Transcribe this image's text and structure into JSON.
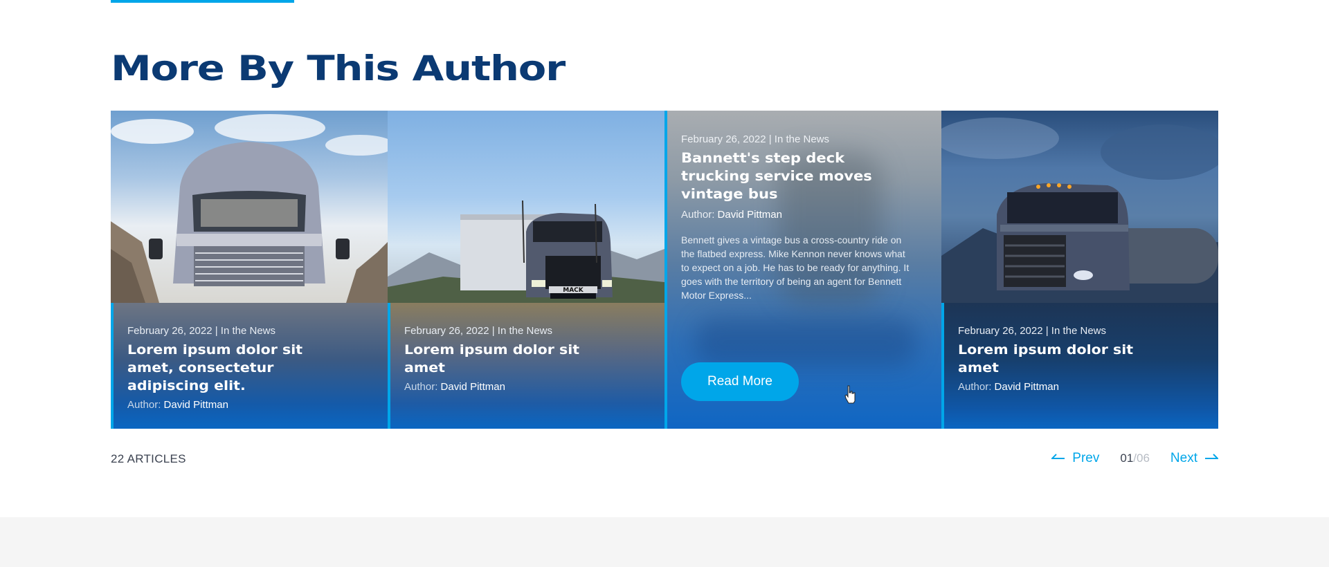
{
  "section": {
    "title": "More By This Author"
  },
  "cards": [
    {
      "date_category": "February 26, 2022 | In the News",
      "title": "Lorem ipsum dolor sit amet, consectetur adipiscing elit.",
      "author_label": "Author:",
      "author_name": "David Pittman"
    },
    {
      "date_category": "February 26, 2022 | In the News",
      "title": "Lorem ipsum dolor sit amet",
      "author_label": "Author:",
      "author_name": "David Pittman",
      "grille_badge": "MACK"
    },
    {
      "date_category": "February 26, 2022 | In the News",
      "title": "Bannett's step deck trucking service moves vintage bus",
      "author_label": "Author:",
      "author_name": "David Pittman",
      "excerpt": "Bennett gives a vintage bus a cross-country ride on the flatbed express. Mike Kennon never knows what to expect on a job. He has to be ready for anything. It goes with the territory of being an agent for Bennett Motor Express...",
      "button_label": "Read More"
    },
    {
      "date_category": "February 26, 2022 | In the News",
      "title": "Lorem ipsum dolor sit amet",
      "author_label": "Author:",
      "author_name": "David Pittman"
    }
  ],
  "footer": {
    "articles_count": "22 ARTICLES",
    "prev_label": "Prev",
    "next_label": "Next",
    "page_current": "01",
    "page_sep_total": "/06"
  },
  "colors": {
    "title": "#0b3a73",
    "accent": "#00a6e9",
    "card_gradient_end": "#0a66c2"
  }
}
